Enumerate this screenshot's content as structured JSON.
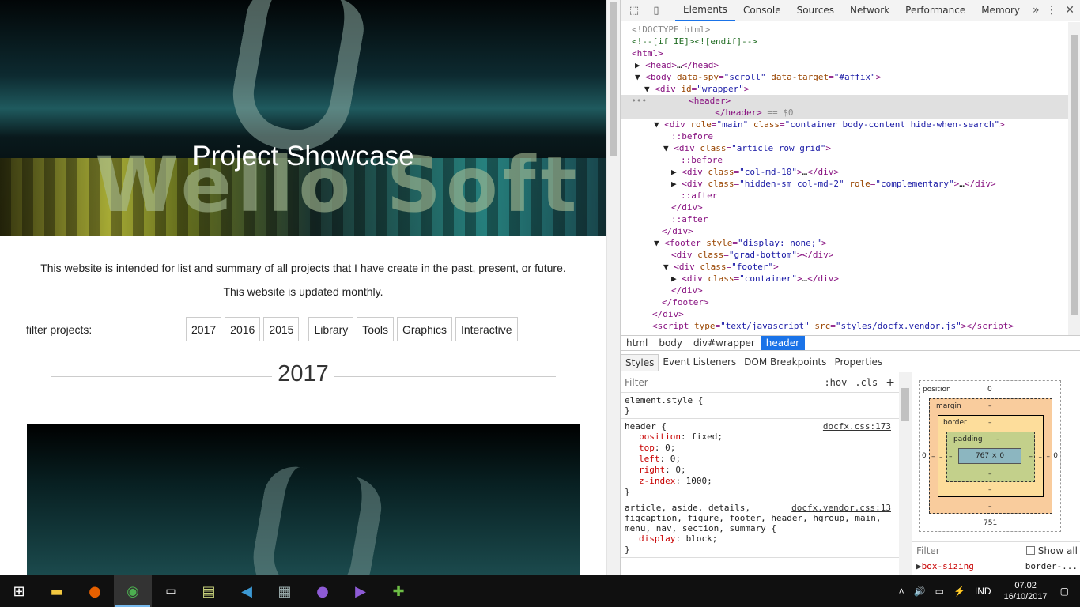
{
  "web": {
    "title": "Project Showcase",
    "banner_word": "Wello Soft",
    "intro_1": "This website is intended for list and summary of all projects that I have create in the past, present, or future.",
    "intro_2": "This website is updated monthly.",
    "filter_label": "filter projects:",
    "filters": [
      "2017",
      "2016",
      "2015",
      "Library",
      "Tools",
      "Graphics",
      "Interactive"
    ],
    "year_heading": "2017"
  },
  "devtools": {
    "tabs": [
      "Elements",
      "Console",
      "Sources",
      "Network",
      "Performance",
      "Memory"
    ],
    "active_tab": "Elements",
    "more": "»",
    "breadcrumbs": [
      "html",
      "body",
      "div#wrapper",
      "header"
    ],
    "subtabs": [
      "Styles",
      "Event Listeners",
      "DOM Breakpoints",
      "Properties"
    ],
    "styles_filter_placeholder": "Filter",
    "hov": ":hov",
    "cls": ".cls",
    "plus": "+",
    "element_style": "element.style {",
    "close_brace": "}",
    "rule1_selector": "header {",
    "rule1_source": "docfx.css:173",
    "rule1_props": [
      [
        "position",
        "fixed"
      ],
      [
        "top",
        "0"
      ],
      [
        "left",
        "0"
      ],
      [
        "right",
        "0"
      ],
      [
        "z-index",
        "1000"
      ]
    ],
    "rule2_selector_1": "article, aside, details,",
    "rule2_selector_2": "figcaption, figure, footer, header, hgroup, main,",
    "rule2_selector_3": "menu, nav, section, summary {",
    "rule2_source": "docfx.vendor.css:13",
    "rule2_props": [
      [
        "display",
        "block"
      ]
    ],
    "box": {
      "position_label": "position",
      "position_value": "0",
      "margin_label": "margin",
      "border_label": "border",
      "padding_label": "padding",
      "dash": "–",
      "content": "767 × 0",
      "zero": "0",
      "width_below": "751"
    },
    "computed_filter": "Filter",
    "show_all": "Show all",
    "computed_prop": "box-sizing",
    "computed_val": "border-..."
  },
  "taskbar": {
    "lang": "IND",
    "time": "07.02",
    "date": "16/10/2017"
  }
}
